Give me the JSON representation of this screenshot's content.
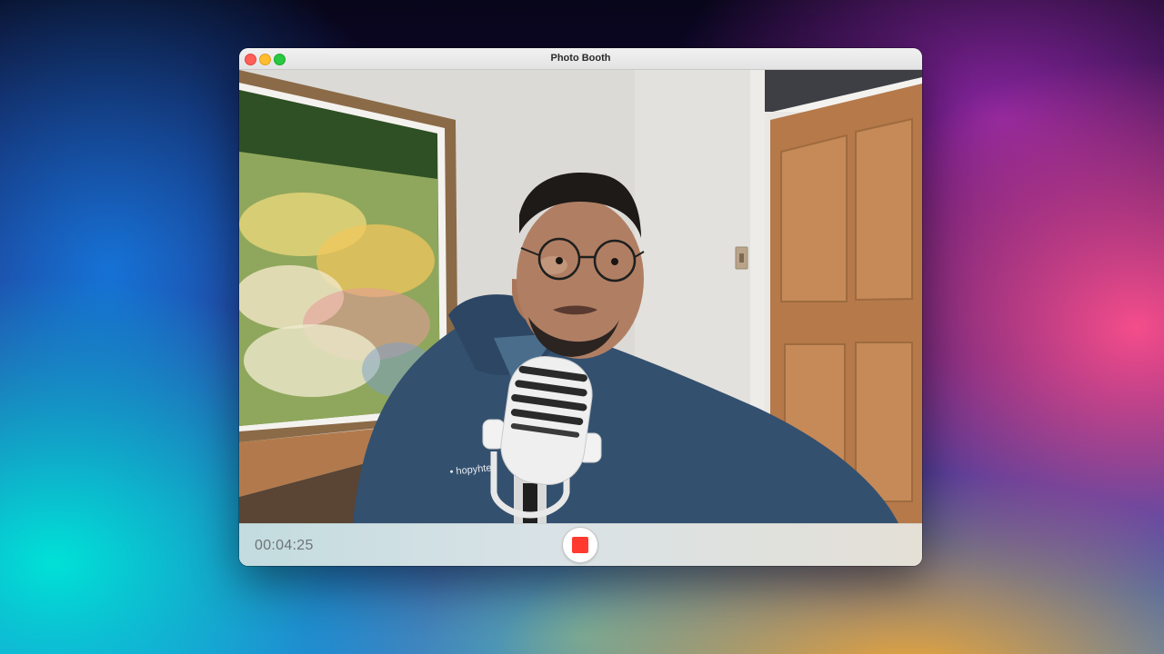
{
  "window": {
    "title": "Photo Booth"
  },
  "controls": {
    "elapsed_time": "00:04:25",
    "record_state": "recording",
    "stop_icon": "stop-square-icon"
  },
  "colors": {
    "record_red": "#ff3b30",
    "close": "#fe5f57",
    "minimize": "#febc2e",
    "maximize": "#28c840"
  }
}
